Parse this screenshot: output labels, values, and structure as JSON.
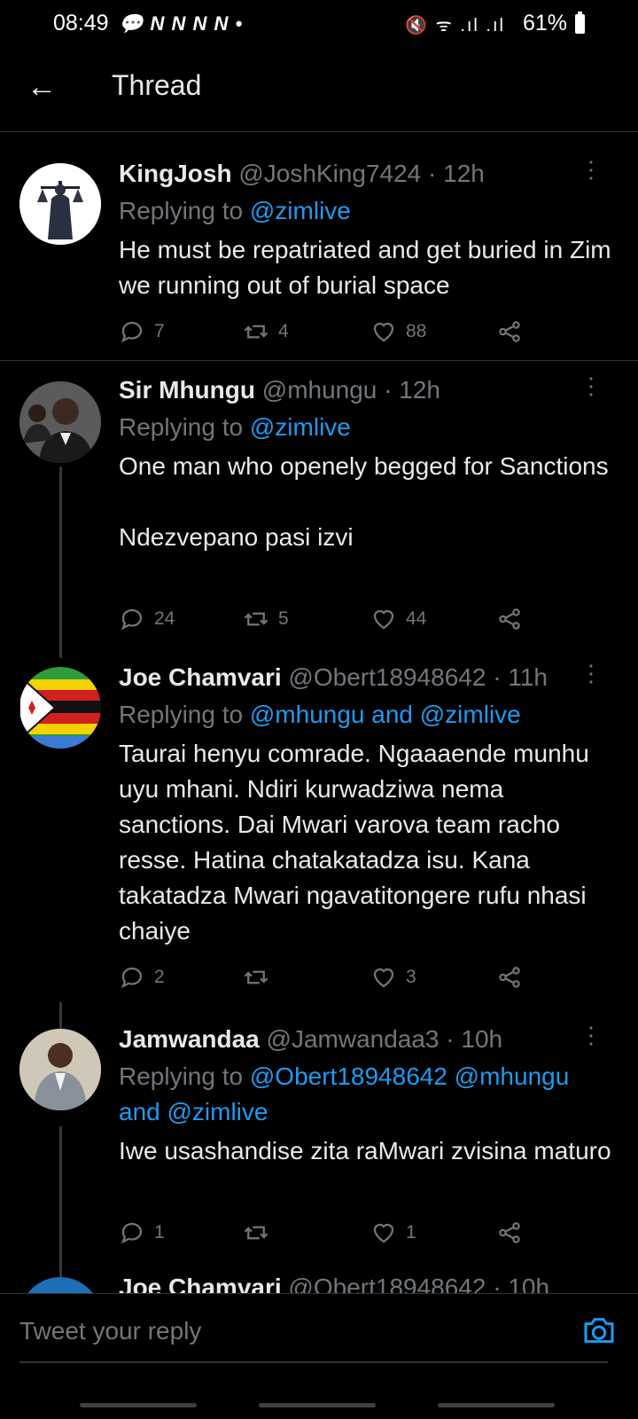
{
  "status_bar": {
    "time": "08:49",
    "notifications": "💬 N N N N •",
    "battery": "61%",
    "icons": "🔇 ᯤ .ıl .ıl"
  },
  "header": {
    "title": "Thread",
    "back_glyph": "←"
  },
  "tweets": [
    {
      "name": "KingJosh",
      "handle": "@JoshKing7424 · 12h",
      "replying_prefix": "Replying to ",
      "replying_to": "@zimlive",
      "text": "He must be repatriated and get buried in Zim we running out of burial space",
      "replies": "7",
      "retweets": "4",
      "likes": "88"
    },
    {
      "name": "Sir Mhungu",
      "handle": "@mhungu · 12h",
      "replying_prefix": "Replying to ",
      "replying_to": "@zimlive",
      "text": "One man who openely begged for Sanctions\n\nNdezvepano pasi izvi",
      "replies": "24",
      "retweets": "5",
      "likes": "44"
    },
    {
      "name": "Joe Chamvari",
      "handle": "@Obert18948642 · 11h",
      "replying_prefix": "Replying to ",
      "replying_to": "@mhungu and @zimlive",
      "text": "Taurai henyu comrade. Ngaaaende munhu uyu mhani. Ndiri kurwadziwa nema sanctions. Dai Mwari varova team racho resse. Hatina chatakatadza isu. Kana takatadza Mwari ngavatitongere rufu nhasi chaiye",
      "replies": "2",
      "retweets": "",
      "likes": "3"
    },
    {
      "name": "Jamwandaa",
      "handle": "@Jamwandaa3 · 10h",
      "replying_prefix": "Replying to ",
      "replying_to": "@Obert18948642 @mhungu and @zimlive",
      "text": "Iwe usashandise zita raMwari zvisina maturo",
      "replies": "1",
      "retweets": "",
      "likes": "1"
    },
    {
      "name": "Joe Chamvari",
      "handle": "@Obert18948642 · 10h"
    }
  ],
  "compose": {
    "placeholder": "Tweet your reply"
  },
  "colors": {
    "background": "#000000",
    "text": "#e7e9ea",
    "muted": "#71767b",
    "link": "#1d9bf0",
    "divider": "#2f3336"
  }
}
